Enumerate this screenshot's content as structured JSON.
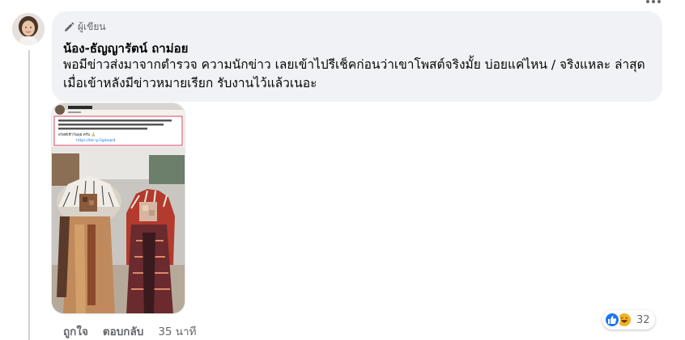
{
  "comment": {
    "author_badge": "ผู้เขียน",
    "commenter_name": "น้อง-ธัญญารัตน์ ถาม่อย",
    "text": "พอมีข่าวส่งมาจากตำรวจ ความนักข่าว เลยเข้าไปรีเช็คก่อนว่าเขาโพสต์จริงมั้ย บ่อยแค่ไหน / จริงแหละ ล่าสุดเมื่อเข้าหลังมีข่าวหมายเรียก รับงานไว้แล้วเนอะ",
    "attachment": {
      "link_text": "https://bit.ly/3gdaqe4",
      "name_line": "สวัสดีเช้าวันพุธ ครับ 🙏"
    },
    "actions": {
      "like_label": "ถูกใจ",
      "reply_label": "ตอบกลับ",
      "time": "35 นาที"
    },
    "reactions": {
      "icons": [
        "like-icon",
        "haha-icon"
      ],
      "count": "32"
    }
  }
}
